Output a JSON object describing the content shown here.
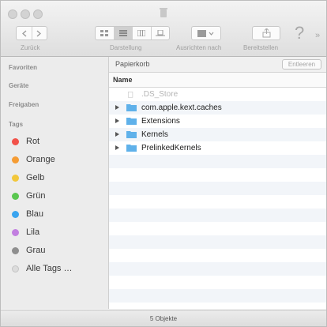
{
  "toolbar": {
    "back_label": "Zurück",
    "view_label": "Darstellung",
    "arrange_label": "Ausrichten nach",
    "share_label": "Bereitstellen",
    "help_glyph": "?",
    "more_glyph": "»"
  },
  "sidebar": {
    "favorites_header": "Favoriten",
    "devices_header": "Geräte",
    "shared_header": "Freigaben",
    "tags_header": "Tags",
    "tags": [
      {
        "label": "Rot",
        "color": "#f2524a"
      },
      {
        "label": "Orange",
        "color": "#f59c34"
      },
      {
        "label": "Gelb",
        "color": "#f2c73b"
      },
      {
        "label": "Grün",
        "color": "#5ac750"
      },
      {
        "label": "Blau",
        "color": "#3aa4ef"
      },
      {
        "label": "Lila",
        "color": "#c27fe0"
      },
      {
        "label": "Grau",
        "color": "#8f8f8f"
      },
      {
        "label": "Alle Tags …",
        "color": "#dcdcdc"
      }
    ]
  },
  "pathbar": {
    "title": "Papierkorb",
    "empty_label": "Entleeren"
  },
  "list": {
    "column_name": "Name",
    "items": [
      {
        "name": ".DS_Store",
        "type": "file",
        "expandable": false
      },
      {
        "name": "com.apple.kext.caches",
        "type": "folder",
        "expandable": true
      },
      {
        "name": "Extensions",
        "type": "folder",
        "expandable": true
      },
      {
        "name": "Kernels",
        "type": "folder",
        "expandable": true
      },
      {
        "name": "PrelinkedKernels",
        "type": "folder",
        "expandable": true
      }
    ]
  },
  "status": {
    "text": "5 Objekte"
  },
  "colors": {
    "folder_blue": "#5fb1ea",
    "stripe": "#f2f5f9"
  }
}
